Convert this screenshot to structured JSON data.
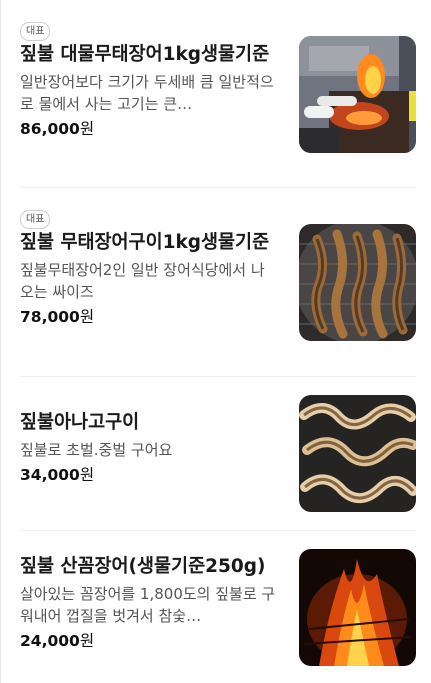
{
  "menu": {
    "items": [
      {
        "badge": "대표",
        "title": "짚불 대물무태장어1kg생물기준",
        "description": "일반장어보다 크기가 두세배 큼 일반적으로 물에서 사는 고기는 큰…",
        "price": "86,000",
        "currency": "원",
        "image": "grill-fire-photo"
      },
      {
        "badge": "대표",
        "title": "짚불 무태장어구이1kg생물기준",
        "description": "짚불무태장어2인 일반 장어식당에서 나오는 싸이즈",
        "price": "78,000",
        "currency": "원",
        "image": "eel-on-grill-photo"
      },
      {
        "badge": "",
        "title": "짚불아나고구이",
        "description": "짚불로 초벌.중벌 구어요",
        "price": "34,000",
        "currency": "원",
        "image": "anago-grill-photo"
      },
      {
        "badge": "",
        "title": "짚불 산꼼장어(생물기준250g)",
        "description": "살아있는 꼼장어를 1,800도의 짚불로 구워내어 껍질을 벗겨서 참숯…",
        "price": "24,000",
        "currency": "원",
        "image": "straw-fire-photo"
      }
    ]
  }
}
